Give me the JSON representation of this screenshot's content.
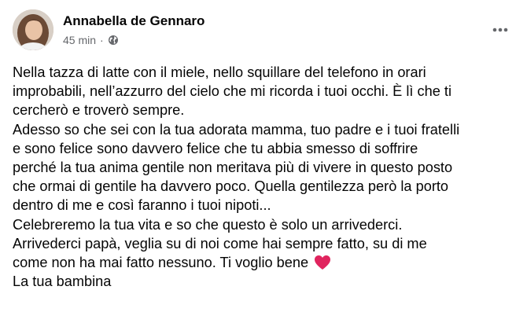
{
  "post": {
    "author": "Annabella de Gennaro",
    "time": "45 min",
    "separator": "·",
    "privacy_icon": "globe-icon",
    "more_icon": "more-options-icon",
    "text_lines": [
      "Nella tazza di latte con il miele, nello squillare del telefono in orari",
      "improbabili, nell’azzurro del cielo che mi ricorda i tuoi occhi. È lì che ti",
      "cercherò e troverò sempre.",
      "Adesso so che sei con la tua adorata mamma, tuo padre e i tuoi fratelli",
      "e sono felice sono davvero felice che tu abbia smesso di soffrire",
      "perché la tua anima gentile non meritava più di vivere in questo posto",
      "che ormai di gentile ha davvero poco. Quella gentilezza però la porto",
      "dentro di me e così faranno i tuoi nipoti...",
      "Celebreremo la tua vita e so che questo è solo un arrivederci.",
      "Arrivederci papà, veglia su di noi come hai sempre fatto, su di me",
      "come non ha mai fatto nessuno. Ti voglio bene",
      "La tua bambina"
    ],
    "heart_icon": "red-heart-icon",
    "heart_color": "#e0245e"
  }
}
